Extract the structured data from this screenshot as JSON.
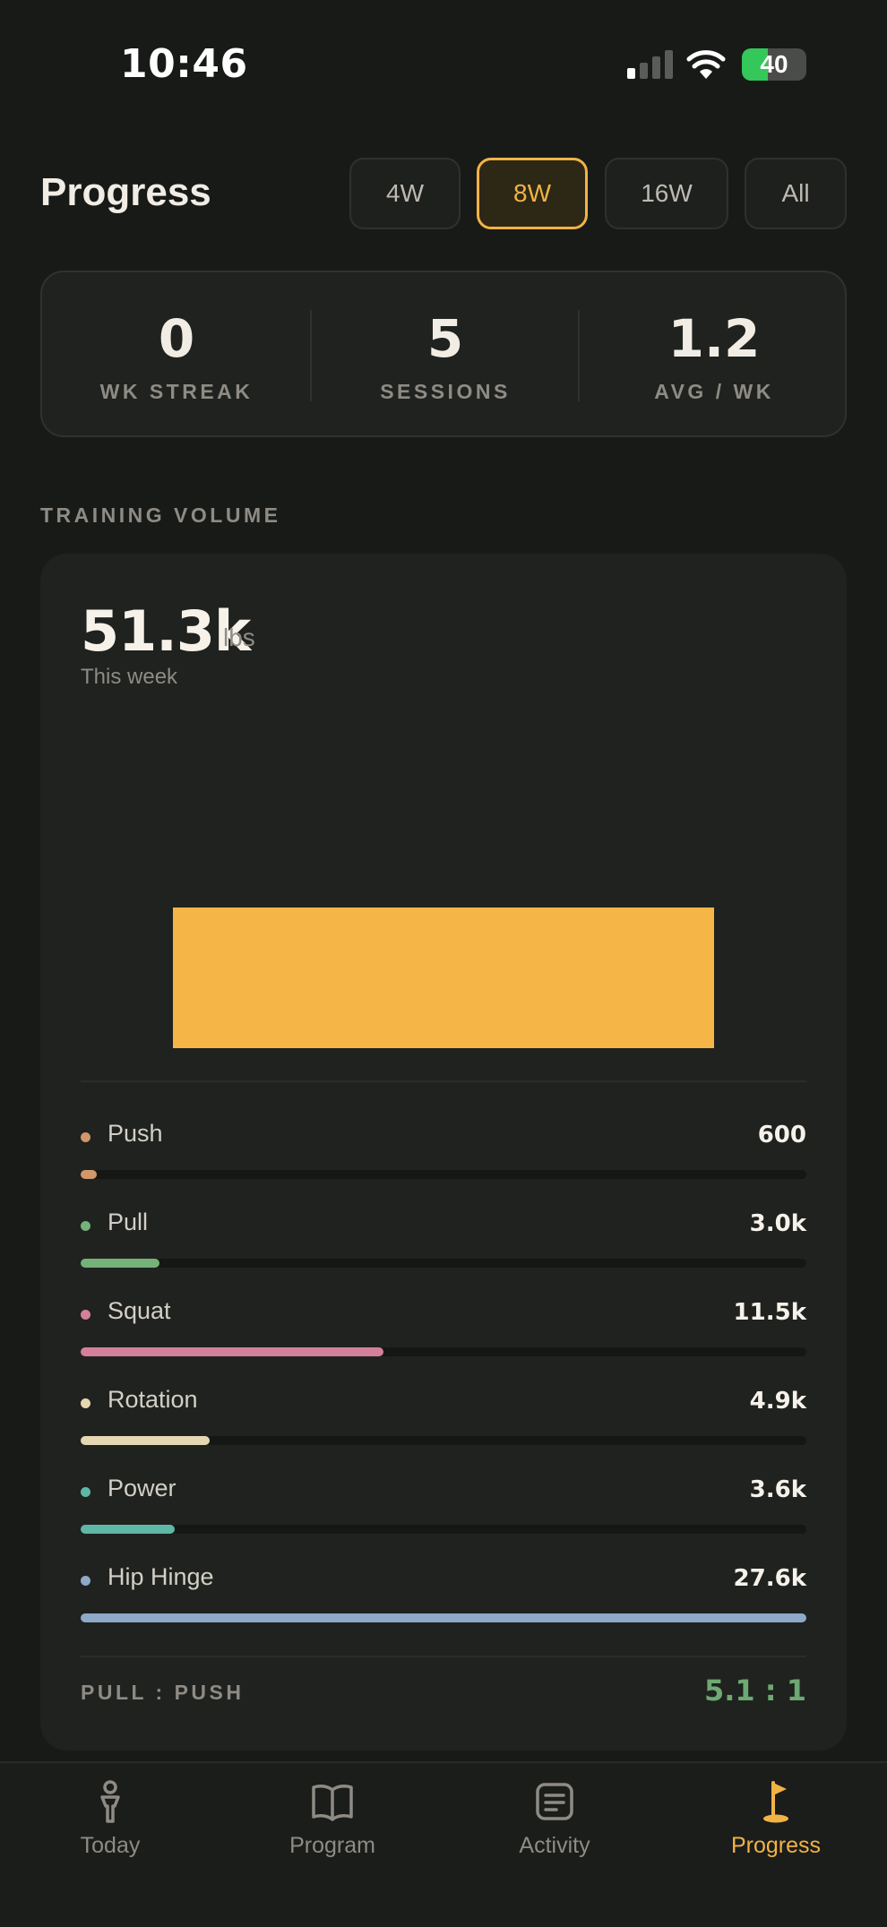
{
  "status_bar": {
    "time": "10:46",
    "battery": "40",
    "battery_level": 0.4,
    "signal_bars": 1
  },
  "header": {
    "title": "Progress",
    "ranges": [
      {
        "label": "4W",
        "active": false
      },
      {
        "label": "8W",
        "active": true
      },
      {
        "label": "16W",
        "active": false
      },
      {
        "label": "All",
        "active": false
      }
    ]
  },
  "stats": [
    {
      "value": "0",
      "label": "WK STREAK"
    },
    {
      "value": "5",
      "label": "SESSIONS"
    },
    {
      "value": "1.2",
      "label": "AVG / WK"
    }
  ],
  "training_volume": {
    "section_label": "TRAINING VOLUME",
    "total": "51.3k",
    "unit": "lbs",
    "subtitle": "This week",
    "categories": [
      {
        "name": "Push",
        "value": "600",
        "fraction": 0.022,
        "color": "#d2966b"
      },
      {
        "name": "Pull",
        "value": "3.0k",
        "fraction": 0.109,
        "color": "#74b27a"
      },
      {
        "name": "Squat",
        "value": "11.5k",
        "fraction": 0.417,
        "color": "#d4809a"
      },
      {
        "name": "Rotation",
        "value": "4.9k",
        "fraction": 0.178,
        "color": "#e6d7b3"
      },
      {
        "name": "Power",
        "value": "3.6k",
        "fraction": 0.13,
        "color": "#5fb8a6"
      },
      {
        "name": "Hip Hinge",
        "value": "27.6k",
        "fraction": 1.0,
        "color": "#8fa9c8"
      }
    ],
    "ratio_label": "PULL : PUSH",
    "ratio_value": "5.1 : 1"
  },
  "chart_data": {
    "type": "bar",
    "categories": [
      "This week"
    ],
    "values": [
      51.3
    ],
    "title": "",
    "xlabel": "",
    "ylabel": "",
    "ylim": [
      0,
      128
    ],
    "grid": false
  },
  "tabs": [
    {
      "label": "Today",
      "icon": "person-icon",
      "active": false
    },
    {
      "label": "Program",
      "icon": "book-icon",
      "active": false
    },
    {
      "label": "Activity",
      "icon": "list-icon",
      "active": false
    },
    {
      "label": "Progress",
      "icon": "flag-icon",
      "active": true
    }
  ]
}
